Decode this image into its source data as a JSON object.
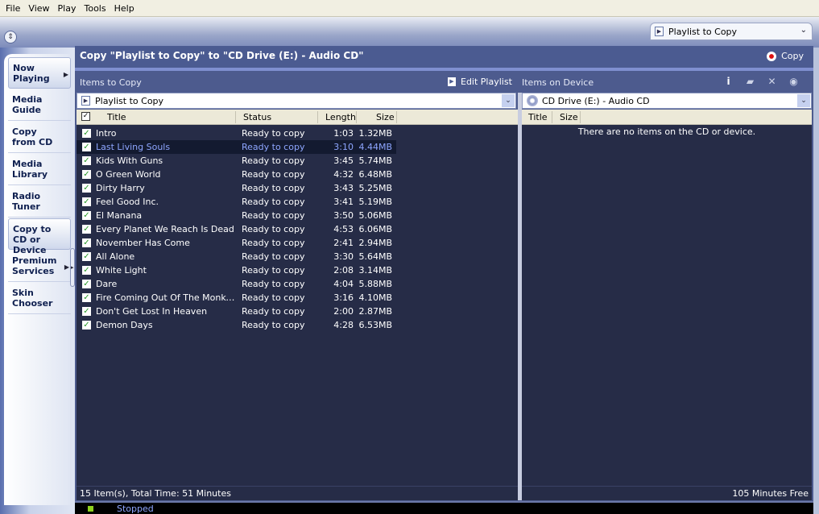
{
  "menu": [
    "File",
    "View",
    "Play",
    "Tools",
    "Help"
  ],
  "playlist_selector": {
    "value": "Playlist to Copy"
  },
  "sidebar": {
    "items": [
      {
        "label": "Now Playing",
        "active": true,
        "arrow": true
      },
      {
        "label": "Media Guide"
      },
      {
        "label": "Copy from CD"
      },
      {
        "label": "Media Library"
      },
      {
        "label": "Radio Tuner"
      },
      {
        "label": "Copy to CD or Device",
        "active": true
      },
      {
        "label": "Premium Services",
        "arrow": true
      },
      {
        "label": "Skin Chooser"
      }
    ]
  },
  "header": {
    "title": "Copy \"Playlist to Copy\" to \"CD Drive (E:) - Audio CD\"",
    "copy_label": "Copy"
  },
  "left": {
    "heading": "Items to Copy",
    "edit_playlist": "Edit Playlist",
    "combo": "Playlist to Copy",
    "columns": [
      "Title",
      "Status",
      "Length",
      "Size"
    ],
    "rows": [
      {
        "title": "Intro",
        "status": "Ready to copy",
        "length": "1:03",
        "size": "1.32MB"
      },
      {
        "title": "Last Living Souls",
        "status": "Ready to copy",
        "length": "3:10",
        "size": "4.44MB",
        "selected": true
      },
      {
        "title": "Kids With Guns",
        "status": "Ready to copy",
        "length": "3:45",
        "size": "5.74MB"
      },
      {
        "title": "O Green World",
        "status": "Ready to copy",
        "length": "4:32",
        "size": "6.48MB"
      },
      {
        "title": "Dirty Harry",
        "status": "Ready to copy",
        "length": "3:43",
        "size": "5.25MB"
      },
      {
        "title": "Feel Good Inc.",
        "status": "Ready to copy",
        "length": "3:41",
        "size": "5.19MB"
      },
      {
        "title": "El Manana",
        "status": "Ready to copy",
        "length": "3:50",
        "size": "5.06MB"
      },
      {
        "title": "Every Planet We Reach Is Dead",
        "status": "Ready to copy",
        "length": "4:53",
        "size": "6.06MB"
      },
      {
        "title": "November Has Come",
        "status": "Ready to copy",
        "length": "2:41",
        "size": "2.94MB"
      },
      {
        "title": "All Alone",
        "status": "Ready to copy",
        "length": "3:30",
        "size": "5.64MB"
      },
      {
        "title": "White Light",
        "status": "Ready to copy",
        "length": "2:08",
        "size": "3.14MB"
      },
      {
        "title": "Dare",
        "status": "Ready to copy",
        "length": "4:04",
        "size": "5.88MB"
      },
      {
        "title": "Fire Coming Out Of The Monkey's...",
        "status": "Ready to copy",
        "length": "3:16",
        "size": "4.10MB"
      },
      {
        "title": "Don't Get Lost In Heaven",
        "status": "Ready to copy",
        "length": "2:00",
        "size": "2.87MB"
      },
      {
        "title": "Demon Days",
        "status": "Ready to copy",
        "length": "4:28",
        "size": "6.53MB"
      }
    ],
    "footer": "15 Item(s), Total Time: 51 Minutes"
  },
  "right": {
    "heading": "Items on Device",
    "combo": "CD Drive (E:) - Audio CD",
    "columns": [
      "Title",
      "Size"
    ],
    "empty": "There are no items on the CD or device.",
    "footer": "105 Minutes Free",
    "icons": [
      "info-icon",
      "folder-icon",
      "delete-icon",
      "cd-erase-icon"
    ]
  },
  "status": {
    "text": "Stopped",
    "led_color": "#8fd11f"
  }
}
